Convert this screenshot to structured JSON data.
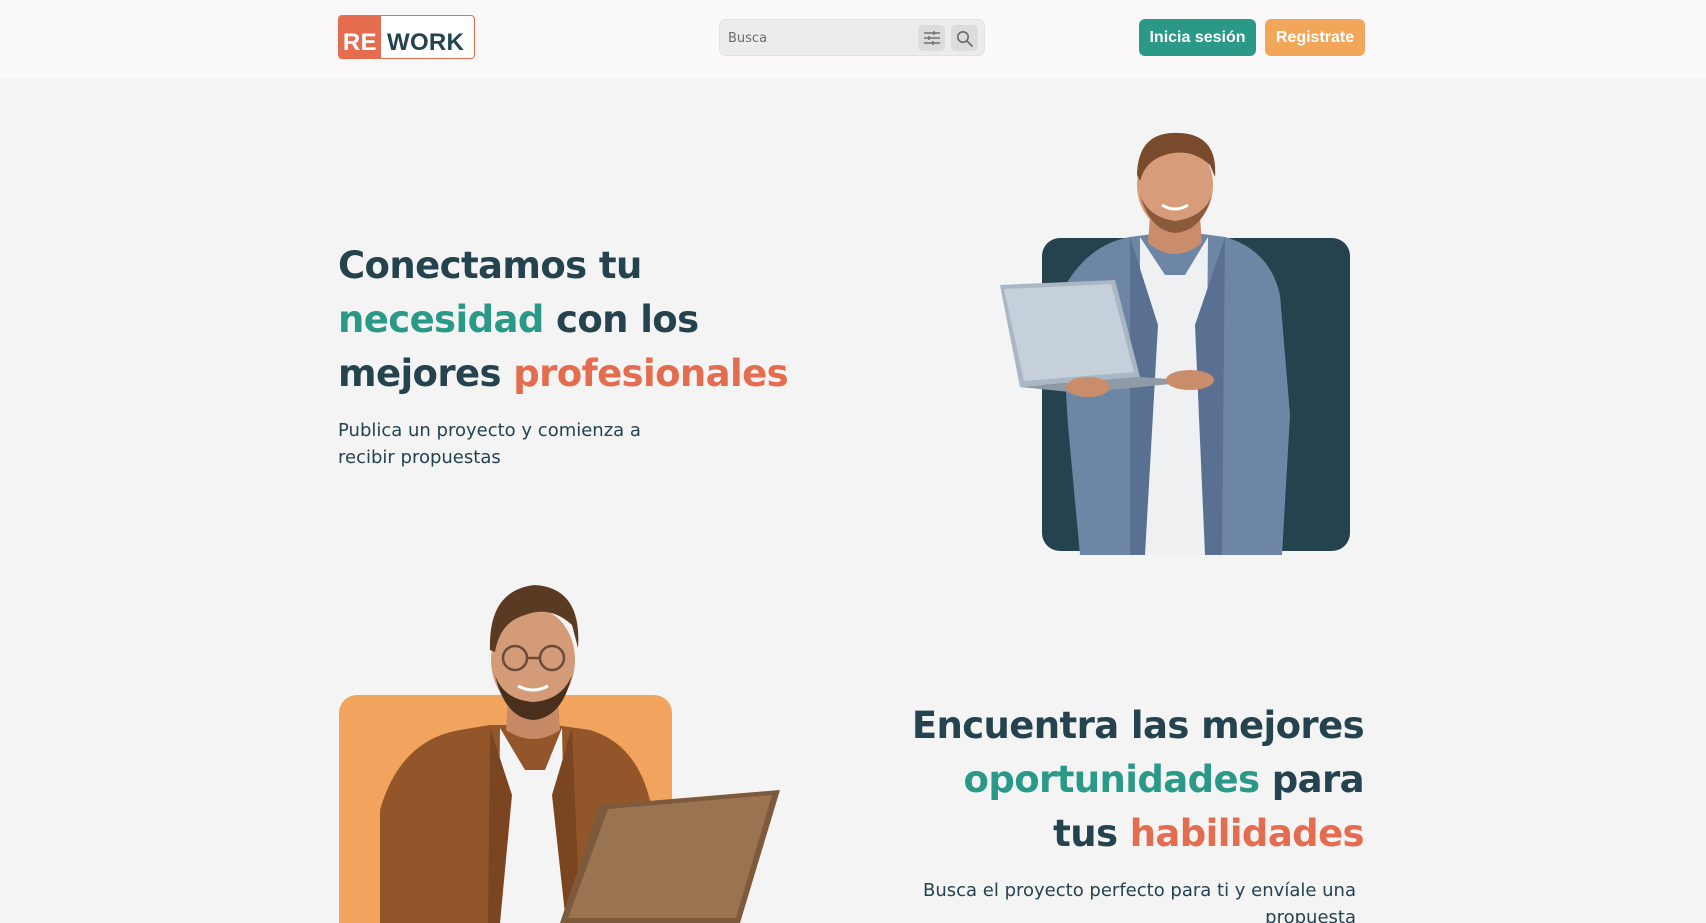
{
  "header": {
    "logo": {
      "re": "RE",
      "work": "WORK"
    },
    "search": {
      "placeholder": "Busca"
    },
    "login_label": "Inicia sesión",
    "register_label": "Registrate"
  },
  "hero1": {
    "title_line1": "Conectamos tu",
    "title_highlight1": "necesidad",
    "title_mid": "con los",
    "title_pre2": "mejores",
    "title_highlight2": "profesionales",
    "subtitle": "Publica un proyecto y comienza a recibir propuestas"
  },
  "hero2": {
    "title_line1": "Encuentra las mejores",
    "title_highlight1": "oportunidades",
    "title_mid": "para",
    "title_pre2": "tus",
    "title_highlight2": "habilidades",
    "subtitle": "Busca el proyecto perfecto para ti y envíale una propuesta"
  },
  "colors": {
    "dark": "#24434f",
    "teal": "#2a9987",
    "orange_text": "#e46c4f",
    "orange_card": "#f2a35d",
    "background": "#f4f4f4"
  },
  "icons": [
    "filter-icon",
    "search-icon"
  ]
}
